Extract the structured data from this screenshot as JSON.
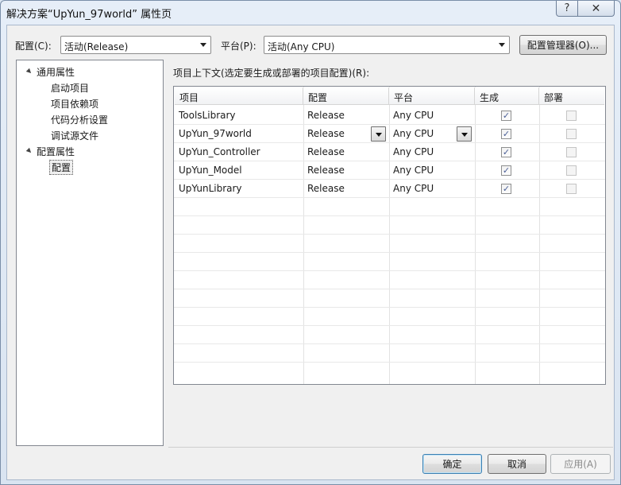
{
  "window": {
    "title": "解决方案“UpYun_97world” 属性页",
    "help_label": "?",
    "close_label": "✕"
  },
  "config_bar": {
    "config_label": "配置(C):",
    "config_value": "活动(Release)",
    "platform_label": "平台(P):",
    "platform_value": "活动(Any CPU)",
    "manager_button": "配置管理器(O)..."
  },
  "tree": {
    "groups": [
      {
        "label": "通用属性",
        "children": [
          "启动项目",
          "项目依赖项",
          "代码分析设置",
          "调试源文件"
        ]
      },
      {
        "label": "配置属性",
        "children": [
          "配置"
        ]
      }
    ]
  },
  "grid": {
    "caption": "项目上下文(选定要生成或部署的项目配置)(R):",
    "columns": [
      "项目",
      "配置",
      "平台",
      "生成",
      "部署"
    ],
    "rows": [
      {
        "project": "ToolsLibrary",
        "config": "Release",
        "platform": "Any CPU",
        "build": true,
        "deploy": false
      },
      {
        "project": "UpYun_97world",
        "config": "Release",
        "platform": "Any CPU",
        "build": true,
        "deploy": false
      },
      {
        "project": "UpYun_Controller",
        "config": "Release",
        "platform": "Any CPU",
        "build": true,
        "deploy": false
      },
      {
        "project": "UpYun_Model",
        "config": "Release",
        "platform": "Any CPU",
        "build": true,
        "deploy": false
      },
      {
        "project": "UpYunLibrary",
        "config": "Release",
        "platform": "Any CPU",
        "build": true,
        "deploy": false
      }
    ],
    "check_glyph": "✓"
  },
  "footer": {
    "ok": "确定",
    "cancel": "取消",
    "apply": "应用(A)"
  }
}
